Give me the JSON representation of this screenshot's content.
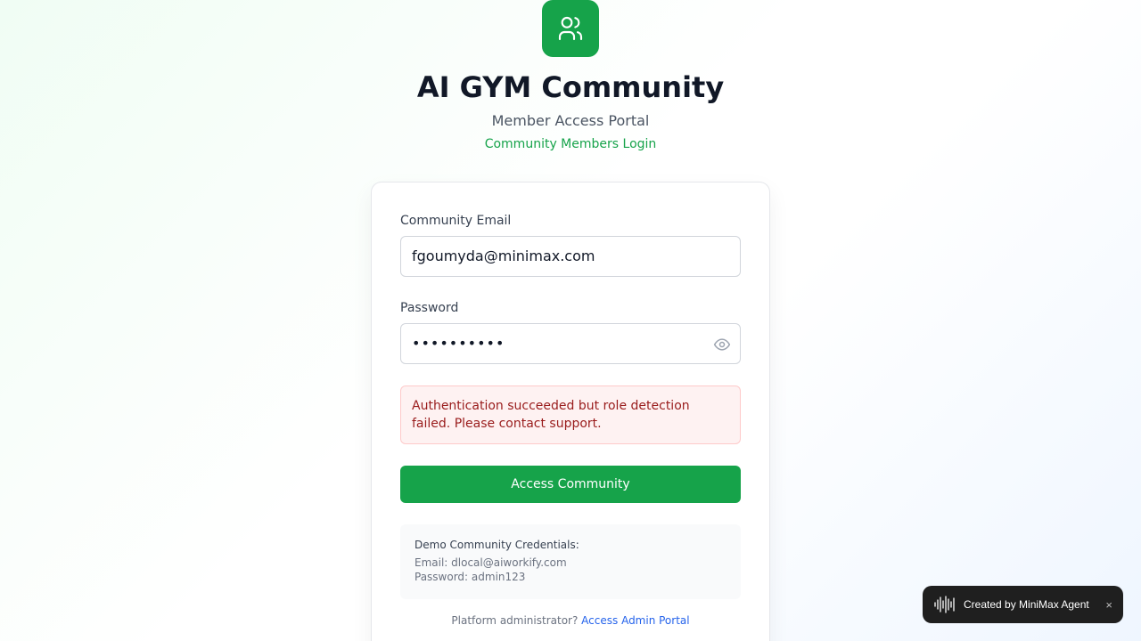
{
  "header": {
    "logo_icon": "users-icon",
    "title": "AI GYM Community",
    "subtitle": "Member Access Portal",
    "subtext": "Community Members Login"
  },
  "form": {
    "email_label": "Community Email",
    "email_value": "fgoumyda@minimax.com",
    "password_label": "Password",
    "password_value": "••••••••••",
    "password_toggle_icon": "eye-icon",
    "error_message": "Authentication succeeded but role detection failed. Please contact support.",
    "submit_label": "Access Community"
  },
  "demo": {
    "title": "Demo Community Credentials:",
    "email": "Email: dlocal@aiworkify.com",
    "password": "Password: admin123"
  },
  "admin": {
    "prompt": "Platform administrator?",
    "link": "Access Admin Portal"
  },
  "badge": {
    "icon": "waveform-icon",
    "text": "Created by MiniMax Agent",
    "close": "×"
  },
  "colors": {
    "accent": "#16a34a",
    "error_bg": "#fef2f2",
    "error_text": "#991b1b",
    "link": "#2563eb"
  }
}
